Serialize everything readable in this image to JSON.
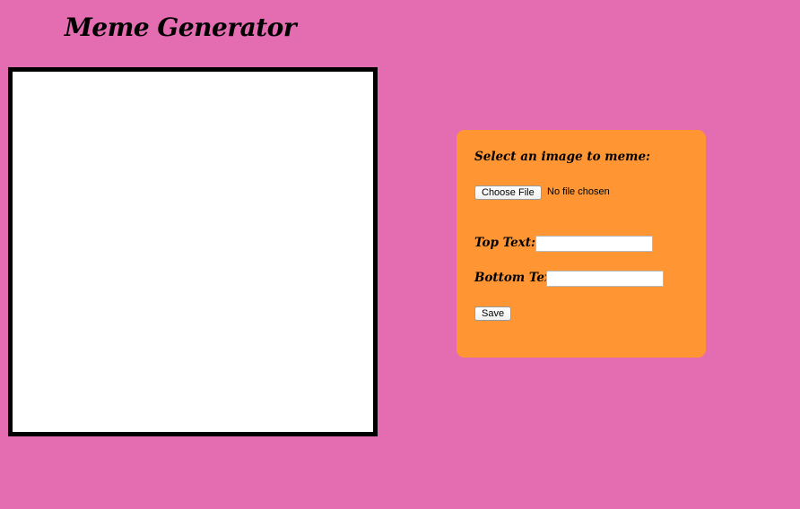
{
  "page": {
    "title": "Meme Generator"
  },
  "canvas": {
    "background": "#ffffff",
    "border_color": "#000000"
  },
  "form": {
    "select_label": "Select an image to meme:",
    "choose_file_label": "Choose File",
    "file_status": "No file chosen",
    "top_text_label": "Top Text:",
    "top_text_value": "",
    "bottom_text_label": "Bottom Text:",
    "bottom_text_value": "",
    "save_label": "Save"
  },
  "colors": {
    "page_background": "#e36db0",
    "panel_background": "#ff9633"
  }
}
